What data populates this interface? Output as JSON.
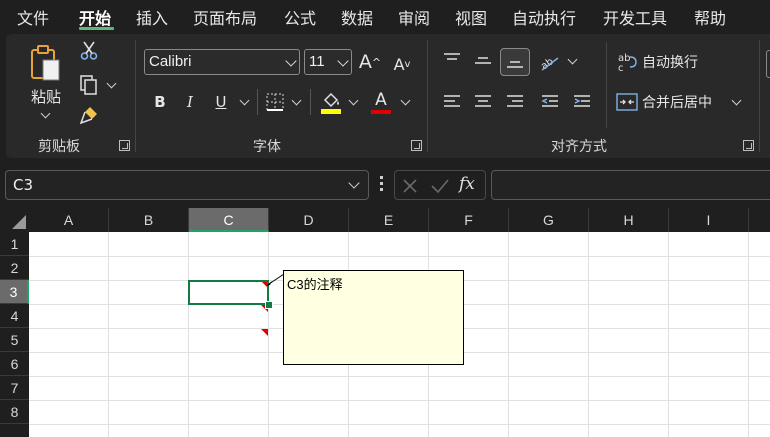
{
  "menu": {
    "items": [
      {
        "label": "文件"
      },
      {
        "label": "开始"
      },
      {
        "label": "插入"
      },
      {
        "label": "页面布局"
      },
      {
        "label": "公式"
      },
      {
        "label": "数据"
      },
      {
        "label": "审阅"
      },
      {
        "label": "视图"
      },
      {
        "label": "自动执行"
      },
      {
        "label": "开发工具"
      },
      {
        "label": "帮助"
      }
    ],
    "active": "开始"
  },
  "ribbon": {
    "clipboard": {
      "paste_label": "粘贴",
      "group_label": "剪贴板"
    },
    "font": {
      "family": "Calibri",
      "size": "11",
      "group_label": "字体",
      "grow_label": "A",
      "shrink_label": "A",
      "bold": "B",
      "italic": "I",
      "underline": "U",
      "font_color_label": "A"
    },
    "alignment": {
      "wrap_label": "自动换行",
      "merge_label": "合并后居中",
      "group_label": "对齐方式"
    }
  },
  "formula_bar": {
    "name_box": "C3",
    "fx_label": "fx",
    "formula": ""
  },
  "grid": {
    "columns": [
      "A",
      "B",
      "C",
      "D",
      "E",
      "F",
      "G",
      "H",
      "I"
    ],
    "rows": [
      "1",
      "2",
      "3",
      "4",
      "5",
      "6",
      "7",
      "8"
    ],
    "selected_cell": "C3",
    "comment_text": "C3的注释"
  },
  "colors": {
    "accent": "#107c41",
    "comment_bg": "#ffffe1",
    "comment_marker": "#e00000"
  }
}
